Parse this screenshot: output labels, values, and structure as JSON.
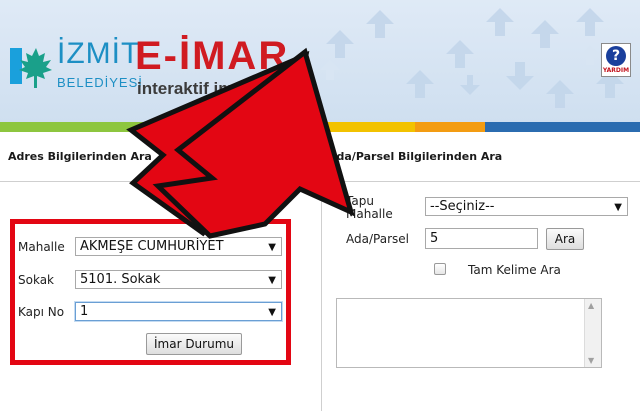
{
  "header": {
    "brand_izmit": "İZMİT",
    "brand_belediye": "BELEDİYESİ",
    "brand_eimar": "E-İMAR",
    "brand_subtitle": "interaktif imar durumu",
    "help_icon": "help-question-icon",
    "help_label": "YARDIM"
  },
  "colors": {
    "brand_red": "#d01b21",
    "brand_blue": "#1d8fc4",
    "strip": [
      "#8dc63f",
      "#1aa0dc",
      "#f2c200",
      "#f39c12",
      "#2b6cb0"
    ],
    "highlight": "#e30613"
  },
  "left_panel": {
    "title": "Adres Bilgilerinden Ara",
    "mahalle_label": "Mahalle",
    "mahalle_value": "AKMEŞE CUMHURİYET",
    "sokak_label": "Sokak",
    "sokak_value": "5101. Sokak",
    "kapino_label": "Kapı No",
    "kapino_value": "1",
    "submit_label": "İmar Durumu"
  },
  "right_panel": {
    "title": "Ada/Parsel Bilgilerinden Ara",
    "tapu_label_line1": "Tapu",
    "tapu_label_line2": "Mahalle",
    "tapu_value": "--Seçiniz--",
    "adaparsel_label": "Ada/Parsel",
    "adaparsel_value": "5",
    "search_label": "Ara",
    "exact_match_label": "Tam Kelime Ara",
    "exact_match_checked": false
  }
}
